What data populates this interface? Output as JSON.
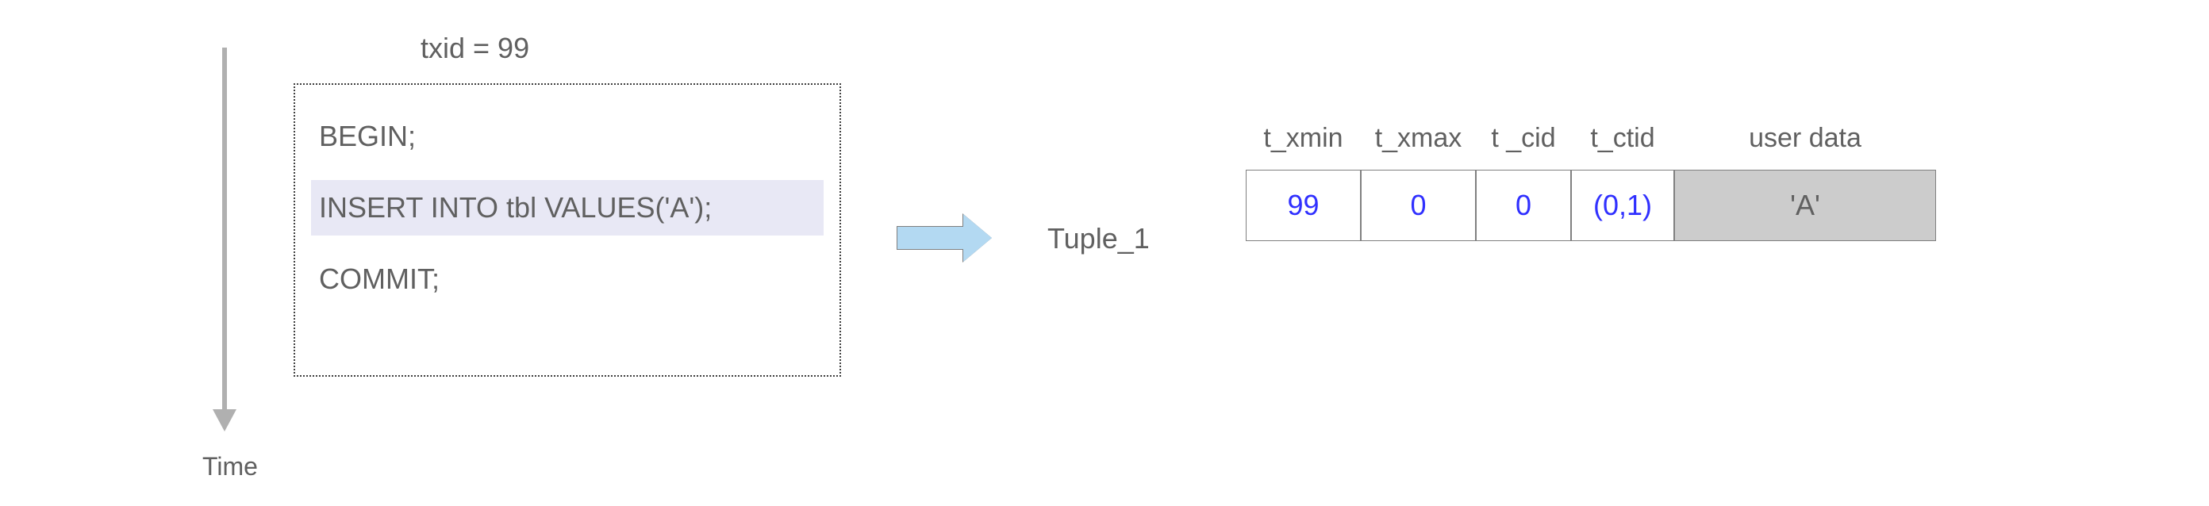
{
  "time": {
    "label": "Time"
  },
  "transaction": {
    "txid_label": "txid = 99",
    "begin": "BEGIN;",
    "insert": "INSERT INTO tbl VALUES('A');",
    "commit": "COMMIT;"
  },
  "tuple": {
    "label": "Tuple_1",
    "headers": {
      "xmin": "t_xmin",
      "xmax": "t_xmax",
      "cid": "t _cid",
      "ctid": "t_ctid",
      "userdata": "user data"
    },
    "values": {
      "xmin": "99",
      "xmax": "0",
      "cid": "0",
      "ctid": "(0,1)",
      "userdata": "'A'"
    }
  }
}
